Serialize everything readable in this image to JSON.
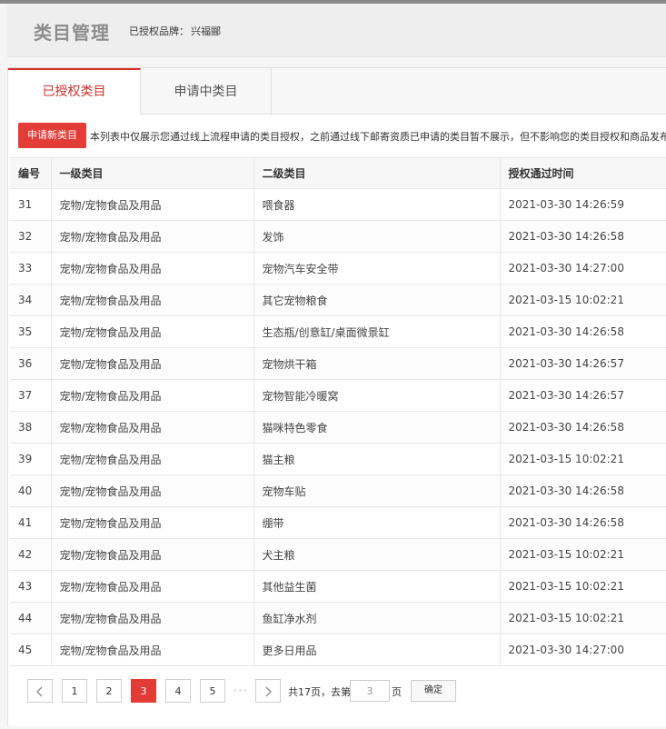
{
  "header": {
    "title": "类目管理",
    "brand_label": "已授权品牌：",
    "brand_value": "兴福郦"
  },
  "tabs": [
    {
      "label": "已授权类目",
      "active": true
    },
    {
      "label": "申请中类目",
      "active": false
    }
  ],
  "notice": {
    "apply_button": "申请新类目",
    "text": "本列表中仅展示您通过线上流程申请的类目授权，之前通过线下邮寄资质已申请的类目暂不展示，但不影响您的类目授权和商品发布，"
  },
  "table": {
    "columns": [
      "编号",
      "一级类目",
      "二级类目",
      "授权通过时间"
    ],
    "rows": [
      [
        "31",
        "宠物/宠物食品及用品",
        "喂食器",
        "2021-03-30 14:26:59"
      ],
      [
        "32",
        "宠物/宠物食品及用品",
        "发饰",
        "2021-03-30 14:26:58"
      ],
      [
        "33",
        "宠物/宠物食品及用品",
        "宠物汽车安全带",
        "2021-03-30 14:27:00"
      ],
      [
        "34",
        "宠物/宠物食品及用品",
        "其它宠物粮食",
        "2021-03-15 10:02:21"
      ],
      [
        "35",
        "宠物/宠物食品及用品",
        "生态瓶/创意缸/桌面微景缸",
        "2021-03-30 14:26:58"
      ],
      [
        "36",
        "宠物/宠物食品及用品",
        "宠物烘干箱",
        "2021-03-30 14:26:57"
      ],
      [
        "37",
        "宠物/宠物食品及用品",
        "宠物智能冷暖窝",
        "2021-03-30 14:26:57"
      ],
      [
        "38",
        "宠物/宠物食品及用品",
        "猫咪特色零食",
        "2021-03-30 14:26:58"
      ],
      [
        "39",
        "宠物/宠物食品及用品",
        "猫主粮",
        "2021-03-15 10:02:21"
      ],
      [
        "40",
        "宠物/宠物食品及用品",
        "宠物车贴",
        "2021-03-30 14:26:58"
      ],
      [
        "41",
        "宠物/宠物食品及用品",
        "绷带",
        "2021-03-30 14:26:58"
      ],
      [
        "42",
        "宠物/宠物食品及用品",
        "犬主粮",
        "2021-03-15 10:02:21"
      ],
      [
        "43",
        "宠物/宠物食品及用品",
        "其他益生菌",
        "2021-03-15 10:02:21"
      ],
      [
        "44",
        "宠物/宠物食品及用品",
        "鱼缸净水剂",
        "2021-03-15 10:02:21"
      ],
      [
        "45",
        "宠物/宠物食品及用品",
        "更多日用品",
        "2021-03-30 14:27:00"
      ]
    ]
  },
  "pagination": {
    "prev_icon": "chevron-left-icon",
    "next_icon": "chevron-right-icon",
    "pages": [
      "1",
      "2",
      "3",
      "4",
      "5"
    ],
    "current_page": "3",
    "ellipsis": "···",
    "total_text": "共17页，去第",
    "goto_value": "3",
    "page_suffix": "页",
    "confirm_label": "确定"
  },
  "colors": {
    "accent": "#e33b36",
    "tab_active": "#d6302b"
  }
}
